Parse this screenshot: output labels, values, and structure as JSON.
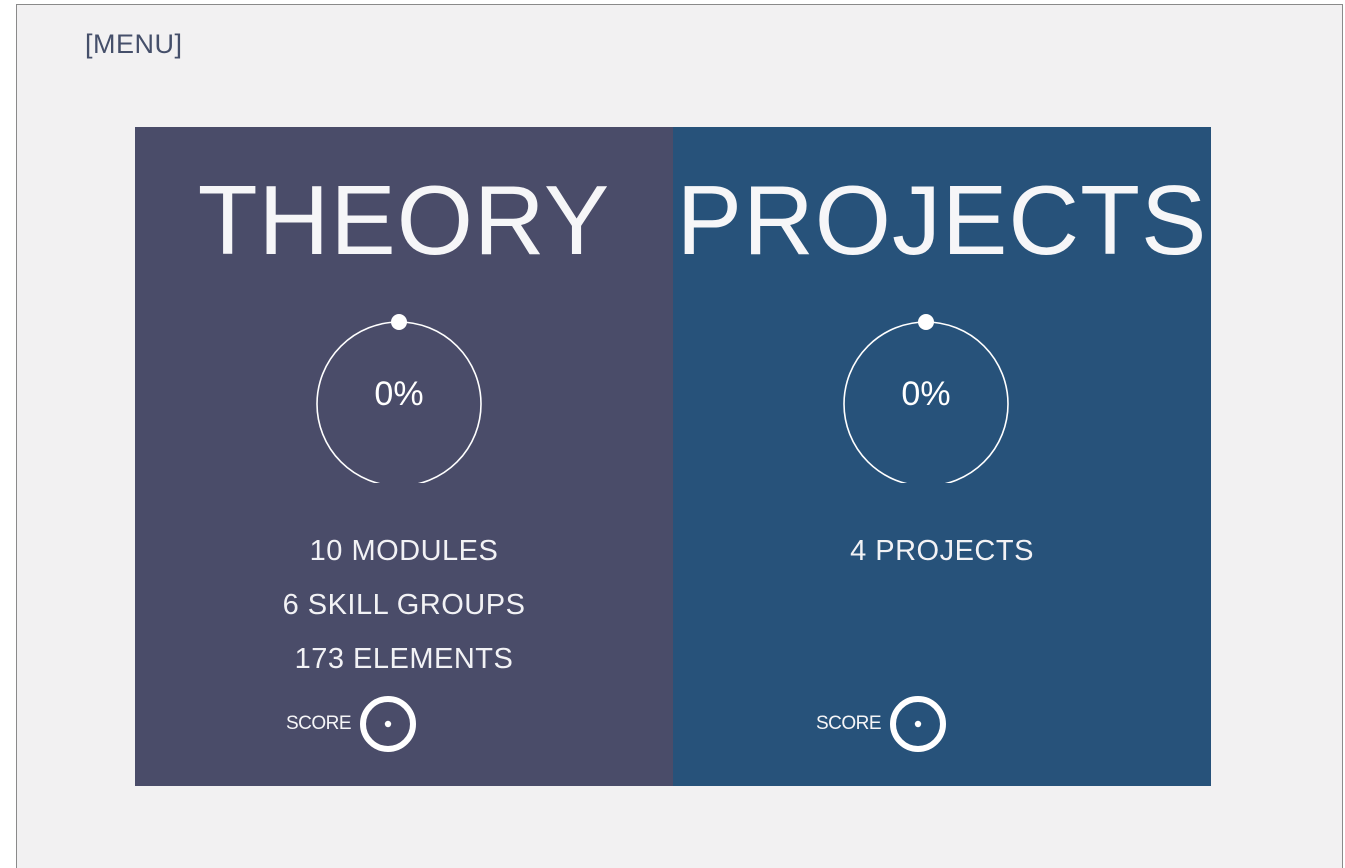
{
  "menu_label": "[MENU]",
  "theory": {
    "title": "THEORY",
    "progress": "0%",
    "progress_fraction": 0,
    "stats": [
      "10 MODULES",
      "6 SKILL GROUPS",
      "173 ELEMENTS"
    ],
    "score_label": "SCORE",
    "color": "#4a4c69"
  },
  "projects": {
    "title": "PROJECTS",
    "progress": "0%",
    "progress_fraction": 0,
    "stats": [
      "4 PROJECTS"
    ],
    "score_label": "SCORE",
    "color": "#27527a"
  },
  "colors": {
    "background": "#f2f1f2",
    "menu_text": "#454f6a",
    "panel_text": "#f4f4f6"
  }
}
